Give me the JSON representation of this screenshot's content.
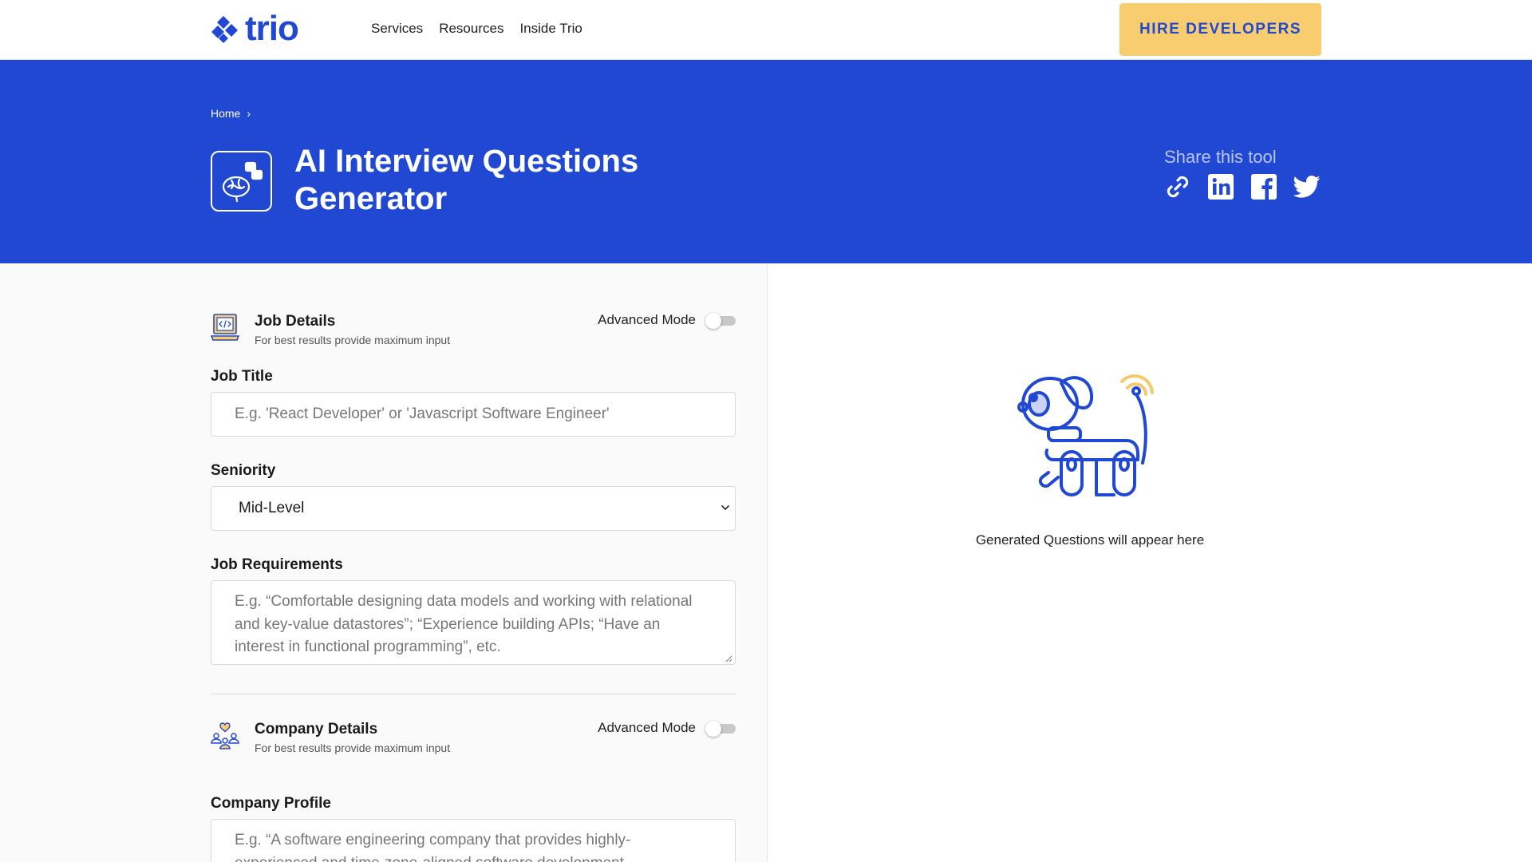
{
  "nav": {
    "logo_text": "trio",
    "links": [
      "Services",
      "Resources",
      "Inside Trio"
    ],
    "cta_label": "HIRE DEVELOPERS"
  },
  "hero": {
    "breadcrumb_home": "Home",
    "breadcrumb_sep": "›",
    "title": "AI Interview Questions Generator",
    "share_label": "Share this tool",
    "share_icons": [
      "link-icon",
      "linkedin-icon",
      "facebook-icon",
      "twitter-icon"
    ]
  },
  "job_details": {
    "title": "Job Details",
    "subtitle": "For best results provide maximum input",
    "advanced_label": "Advanced Mode",
    "advanced_on": false,
    "job_title_label": "Job Title",
    "job_title_placeholder": "E.g. 'React Developer' or 'Javascript Software Engineer'",
    "seniority_label": "Seniority",
    "seniority_value": "Mid-Level",
    "requirements_label": "Job Requirements",
    "requirements_placeholder": "E.g. “Comfortable designing data models and working with relational and key-value datastores”; “Experience building APIs; “Have an interest in functional programming”, etc."
  },
  "company_details": {
    "title": "Company Details",
    "subtitle": "For best results provide maximum input",
    "advanced_label": "Advanced Mode",
    "advanced_on": false,
    "profile_label": "Company Profile",
    "profile_placeholder": "E.g. “A software engineering company that provides highly-experienced and time-zone-aligned software development"
  },
  "output": {
    "empty_message": "Generated Questions will appear here"
  },
  "colors": {
    "brand_blue": "#2148d2",
    "cta_yellow": "#f7cd70",
    "accent_yellow": "#f3c96a"
  }
}
